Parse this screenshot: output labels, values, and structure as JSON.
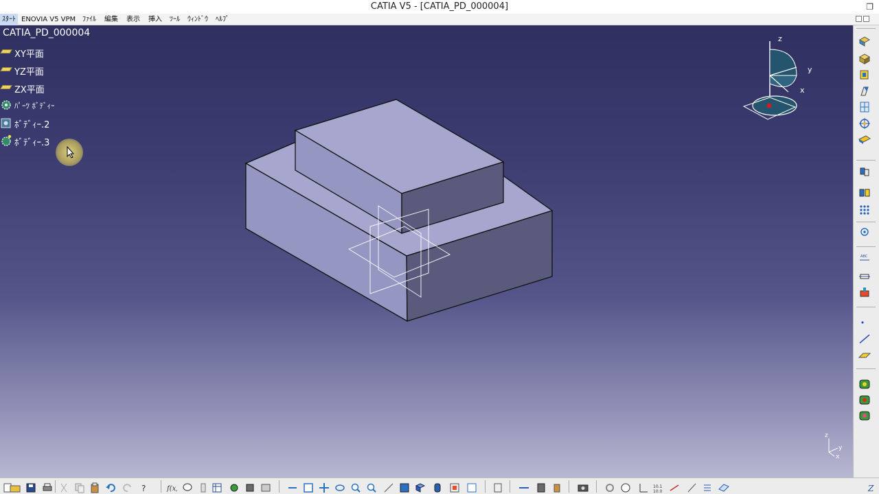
{
  "window": {
    "title": "CATIA V5 - [CATIA_PD_000004]"
  },
  "menu": [
    {
      "label": "ｽﾀｰﾄ"
    },
    {
      "label": "ENOVIA V5 VPM"
    },
    {
      "label": "ﾌｧｲﾙ"
    },
    {
      "label": "編集"
    },
    {
      "label": "表示"
    },
    {
      "label": "挿入"
    },
    {
      "label": "ﾂｰﾙ"
    },
    {
      "label": "ｳｨﾝﾄﾞｳ"
    },
    {
      "label": "ﾍﾙﾌﾟ"
    }
  ],
  "tree": {
    "root": "CATIA_PD_000004",
    "nodes": [
      {
        "label": "XY平面",
        "icon": "plane-icon"
      },
      {
        "label": "YZ平面",
        "icon": "plane-icon"
      },
      {
        "label": "ZX平面",
        "icon": "plane-icon"
      },
      {
        "label": "ﾊﾟｰﾂ ﾎﾞﾃﾞｨｰ",
        "icon": "part-body-icon"
      },
      {
        "label": "ﾎﾞﾃﾞｨｰ.2",
        "icon": "body-icon"
      },
      {
        "label": "ﾎﾞﾃﾞｨｰ.3",
        "icon": "body-icon"
      }
    ]
  },
  "compass": {
    "z": "z",
    "y": "y",
    "x": "x"
  },
  "axis_triad": {
    "z": "z",
    "y": "y",
    "x": "x"
  },
  "colors": {
    "viewport_top": "#2f2f60",
    "viewport_bottom": "#b8b8d2",
    "solid_top": "#a6a6ce",
    "solid_left": "#9696c2",
    "solid_right": "#5a5a7c"
  },
  "right_toolbar": [
    "sketcher-icon",
    "pad-icon",
    "pocket-icon",
    "shaft-icon",
    "hole-icon",
    "fillet-icon",
    "chamfer-icon",
    "boolean-icon",
    "transform-icon",
    "pattern-icon",
    "measure-icon",
    "annotation-icon",
    "constraint-icon",
    "apply-material-icon",
    "point-icon",
    "line-icon",
    "plane-icon",
    "publish-icon",
    "instantiate-icon",
    "catalog-icon"
  ],
  "bottom_toolbar": [
    "new-icon",
    "open-icon",
    "save-icon",
    "print-icon",
    "cut-icon",
    "copy-icon",
    "paste-icon",
    "undo-icon",
    "redo-icon",
    "help-icon",
    "formula-icon",
    "comment-icon",
    "table-icon",
    "knowledge-icon",
    "parameters-icon",
    "fly-icon",
    "fit-all-icon",
    "pan-icon",
    "rotate-icon",
    "zoom-in-icon",
    "zoom-out-icon",
    "normal-view-icon",
    "iso-view-icon",
    "shading-icon",
    "hide-show-icon",
    "swap-icon",
    "render-icon",
    "manipulation-icon",
    "update-icon",
    "camera-icon",
    "refresh-icon",
    "compass-icon",
    "axis-icon",
    "scale-icon",
    "measure-icon",
    "dimension-icon",
    "grid-icon",
    "sketch-plane-icon"
  ]
}
